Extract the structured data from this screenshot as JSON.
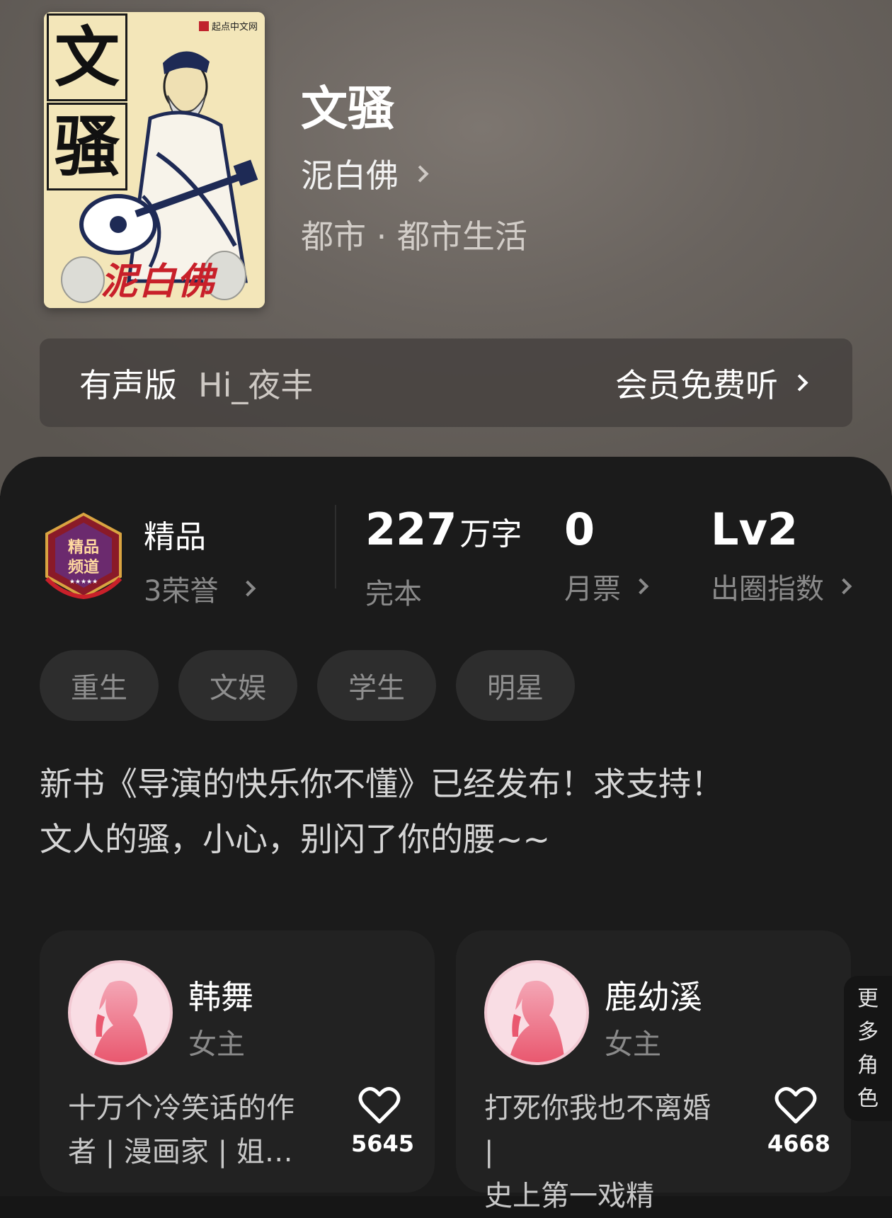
{
  "book": {
    "title": "文骚",
    "author": "泥白佛",
    "genre": "都市 · 都市生活",
    "cover": {
      "title_chars": [
        "文",
        "骚"
      ],
      "publisher": "起点中文网",
      "author_signature": "泥白佛"
    }
  },
  "audio": {
    "label": "有声版",
    "narrator": "Hi_夜丰",
    "cta": "会员免费听"
  },
  "stats": {
    "badge_text": "精品频道",
    "quality_label": "精品",
    "honors": "3荣誉",
    "word_count": "227",
    "word_unit": "万字",
    "status": "完本",
    "monthly_votes": "0",
    "monthly_votes_label": "月票",
    "level": "Lv2",
    "level_label": "出圈指数"
  },
  "tags": [
    "重生",
    "文娱",
    "学生",
    "明星"
  ],
  "description": {
    "line1": "新书《导演的快乐你不懂》已经发布！求支持！",
    "line2": "文人的骚，小心，别闪了你的腰~~"
  },
  "roles": [
    {
      "name": "韩舞",
      "type": "女主",
      "desc_line1": "十万个冷笑话的作",
      "desc_line2": "者 | 漫画家 | 姐…",
      "likes": "5645"
    },
    {
      "name": "鹿幼溪",
      "type": "女主",
      "desc_line1": "打死你我也不离婚 |",
      "desc_line2": "史上第一戏精",
      "likes": "4668"
    }
  ],
  "more_roles": [
    "更",
    "多",
    "角",
    "色"
  ],
  "colors": {
    "panel": "#1b1b1b",
    "card": "#222222",
    "tag_bg": "#2d2d2d",
    "badge_red": "#c8202a",
    "avatar_pink": "#f9dde4"
  }
}
